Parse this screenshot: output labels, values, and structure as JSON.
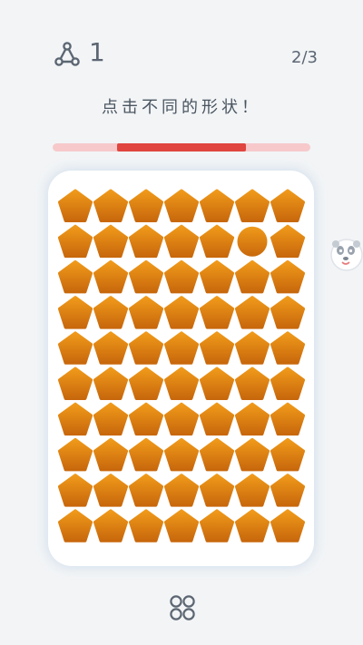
{
  "header": {
    "score_icon": "triangle-network-icon",
    "score": "1",
    "level_progress": "2/3"
  },
  "instruction": "点击不同的形状！",
  "timer": {
    "fraction_remaining": 0.5,
    "fill_color": "#e0453f",
    "track_color": "#f7c9cb"
  },
  "board": {
    "rows": 10,
    "cols": 7,
    "shape": "pentagon",
    "odd_shape": "circle",
    "odd_row": 2,
    "odd_col": 6,
    "shape_color_top": "#f09a1a",
    "shape_color_bottom": "#c8680c"
  },
  "side_mascot": "panda-face-icon",
  "footer": {
    "menu_icon": "four-circles-menu-icon"
  }
}
